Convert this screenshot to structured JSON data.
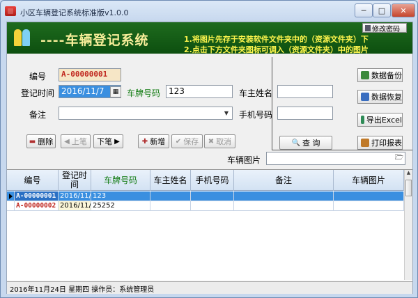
{
  "window": {
    "title": "小区车辆登记系统标准版v1.0.0",
    "minimize": "─",
    "maximize": "□",
    "close": "✕"
  },
  "banner": {
    "title": "----车辆登记系统",
    "tip1": "1.将图片先存于安装软件文件夹中的（资源文件夹）下",
    "tip2": "2.点击下方文件夹图标可调入（资源文件夹）中的图片",
    "password_button": "修改密码"
  },
  "form": {
    "code_label": "编号",
    "code_value": "A-00000001",
    "date_label": "登记时间",
    "date_value": "2016/11/7",
    "plate_label": "车牌号码",
    "plate_value": "123",
    "owner_label": "车主姓名",
    "owner_value": "",
    "remark_label": "备注",
    "remark_value": "",
    "phone_label": "手机号码",
    "phone_value": "",
    "image_label": "车辆图片",
    "image_value": "",
    "query_button": "查  询"
  },
  "toolbar": {
    "delete": "删除",
    "prev": "上笔",
    "next": "下笔",
    "add": "新增",
    "save": "保存",
    "cancel": "取消"
  },
  "side_buttons": {
    "backup": "数据备份",
    "restore": "数据恢复",
    "export": "导出Excel",
    "print": "打印报表"
  },
  "table": {
    "columns": [
      "编号",
      "登记时间",
      "车牌号码",
      "车主姓名",
      "手机号码",
      "备注",
      "车辆图片"
    ],
    "rows": [
      [
        "A-00000001",
        "2016/11/7",
        "123",
        "",
        "",
        "",
        ""
      ],
      [
        "A-00000002",
        "2016/11/24",
        "25252",
        "",
        "",
        "",
        ""
      ]
    ]
  },
  "status": {
    "text": "2016年11月24日   星期四  操作员：系统管理员"
  }
}
